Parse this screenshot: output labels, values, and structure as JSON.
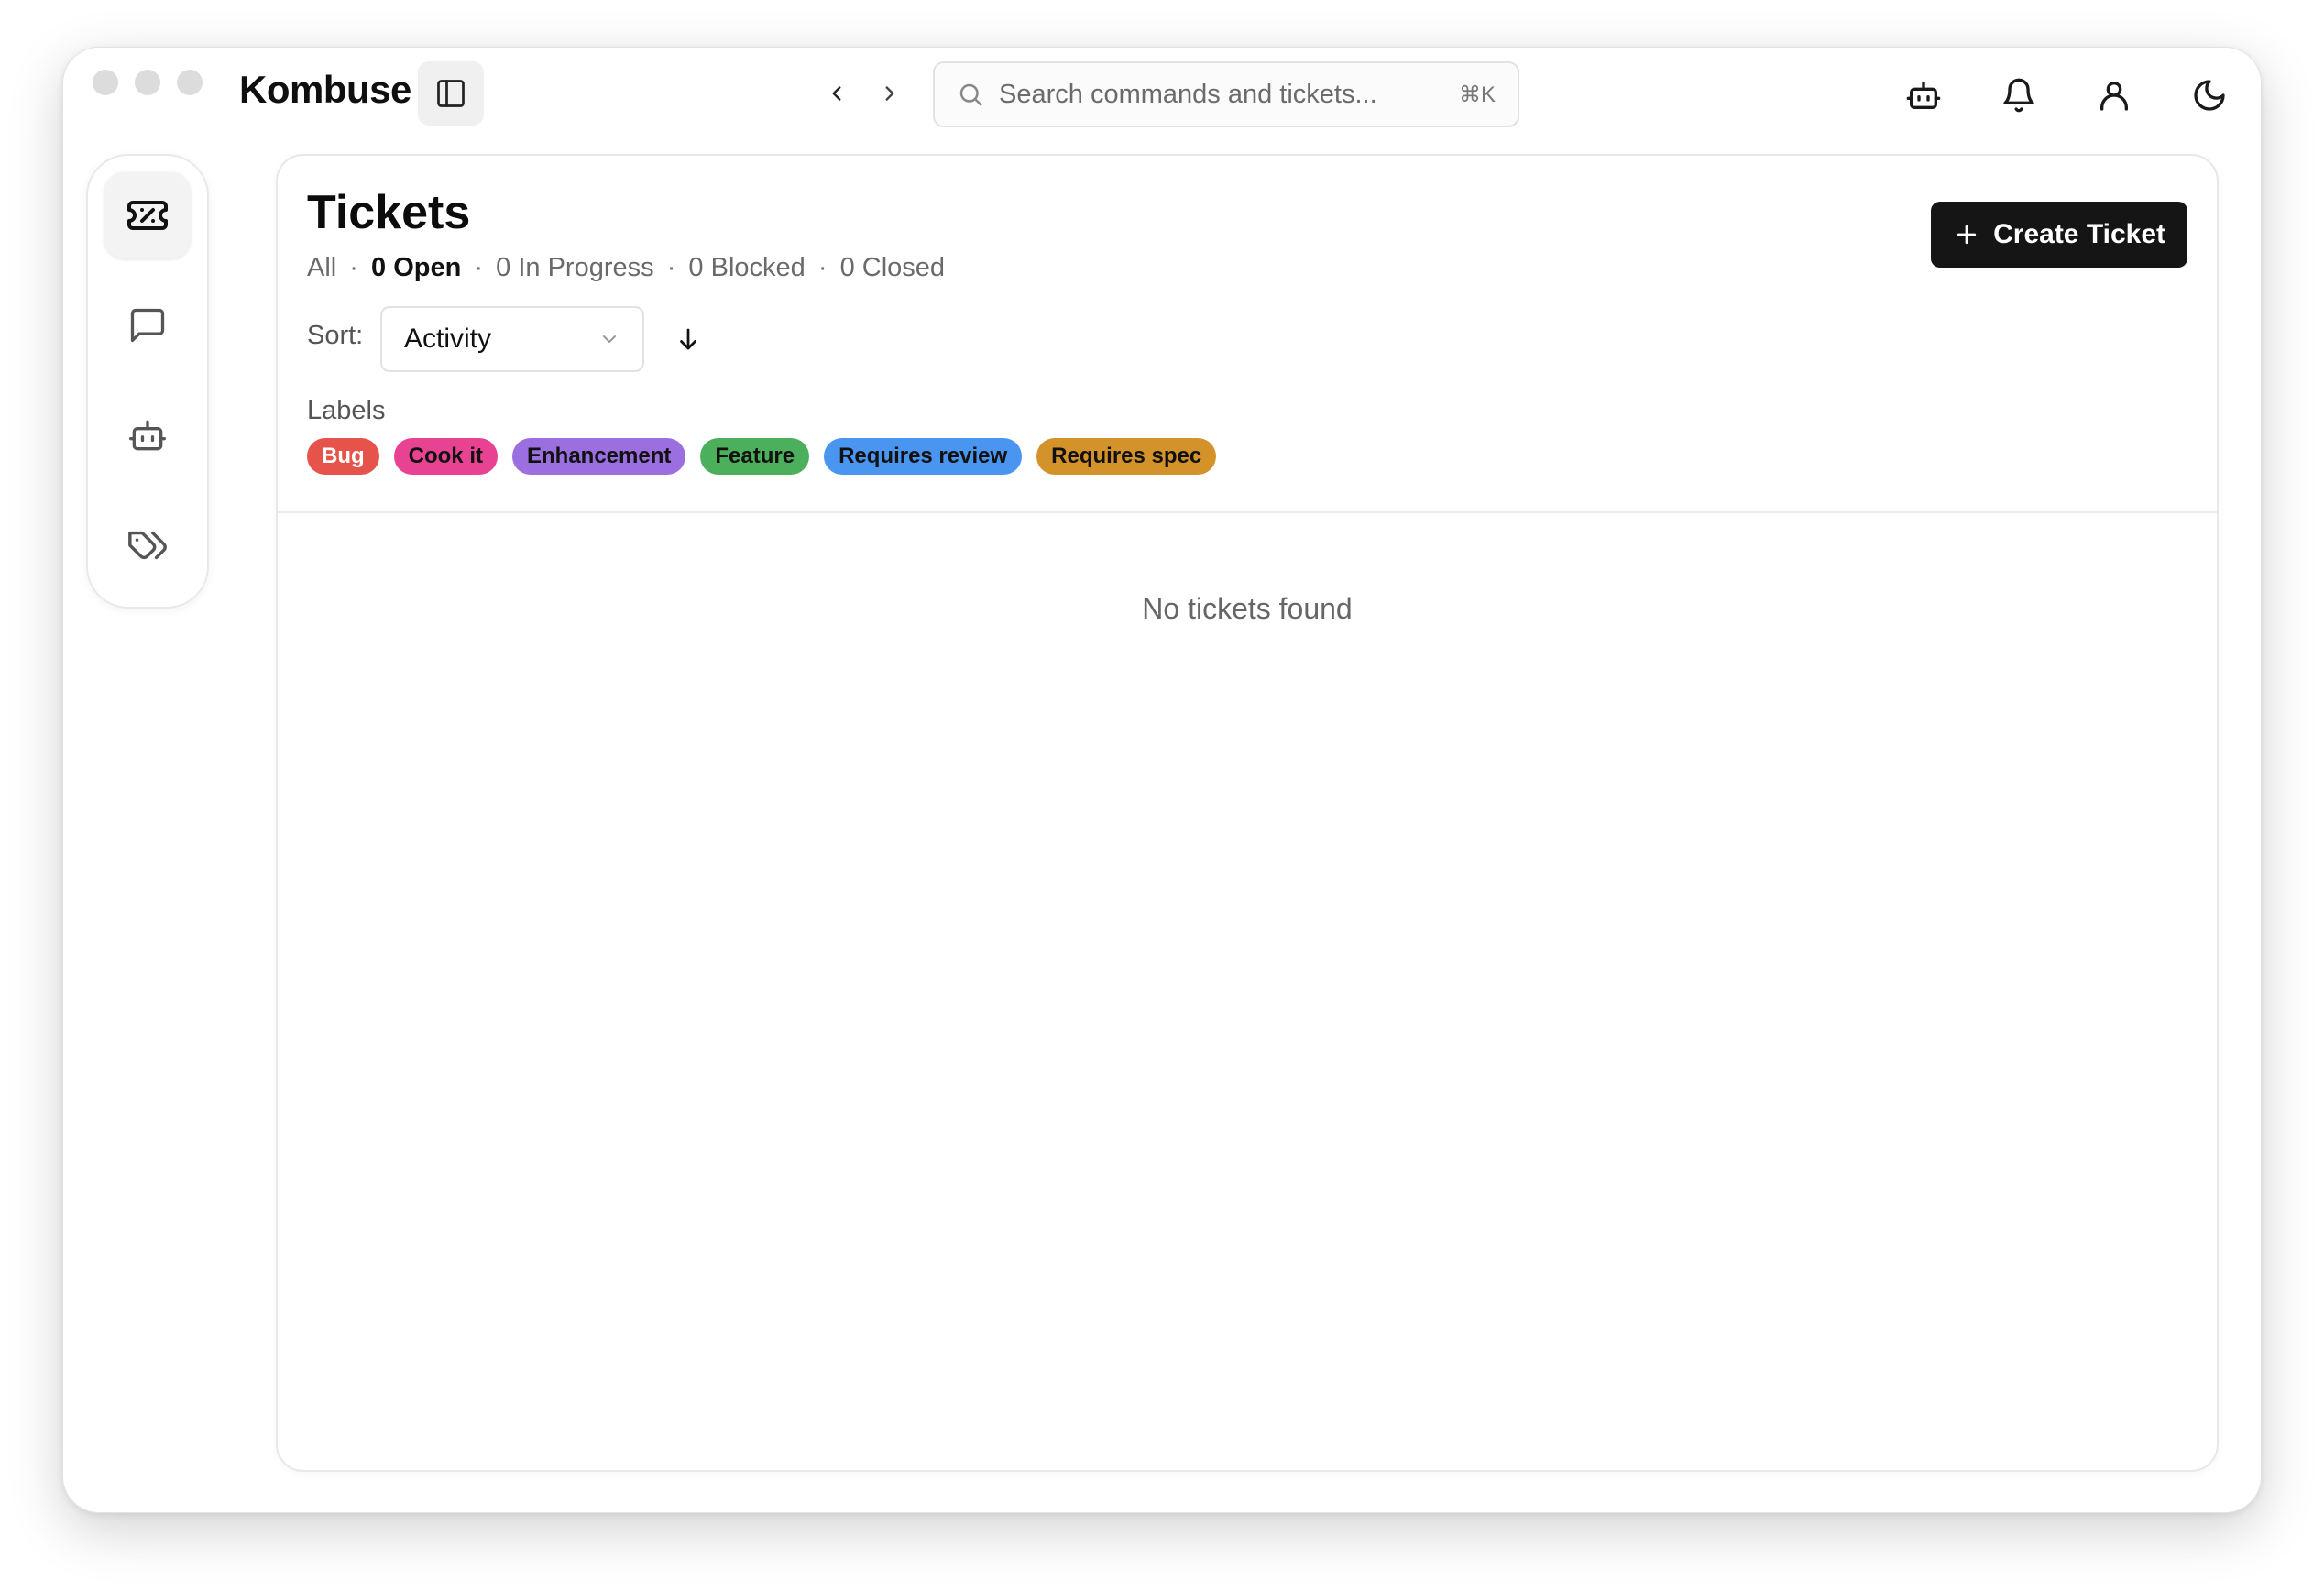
{
  "app": {
    "title": "Kombuse"
  },
  "search": {
    "placeholder": "Search commands and tickets...",
    "shortcut": "⌘K"
  },
  "topbar": {
    "icons": [
      "robot-icon",
      "bell-icon",
      "user-icon",
      "moon-icon"
    ]
  },
  "rail": {
    "items": [
      {
        "name": "tickets",
        "icon": "ticket-icon",
        "active": true
      },
      {
        "name": "chats",
        "icon": "message-icon",
        "active": false
      },
      {
        "name": "agents",
        "icon": "robot-icon",
        "active": false
      },
      {
        "name": "labels",
        "icon": "tags-icon",
        "active": false
      }
    ]
  },
  "page": {
    "title": "Tickets",
    "filters": {
      "all": "All",
      "open": "0 Open",
      "in_progress": "0 In Progress",
      "blocked": "0 Blocked",
      "closed": "0 Closed",
      "separator": "·"
    },
    "create_button": "Create Ticket",
    "sort": {
      "label": "Sort:",
      "value": "Activity"
    },
    "labels": {
      "title": "Labels",
      "items": [
        {
          "text": "Bug",
          "color": "#e5534b"
        },
        {
          "text": "Cook it",
          "color": "#e84393"
        },
        {
          "text": "Enhancement",
          "color": "#9b6fe0"
        },
        {
          "text": "Feature",
          "color": "#4caf5c"
        },
        {
          "text": "Requires review",
          "color": "#4a95f0"
        },
        {
          "text": "Requires spec",
          "color": "#d4922a"
        }
      ]
    },
    "empty_state": "No tickets found"
  }
}
